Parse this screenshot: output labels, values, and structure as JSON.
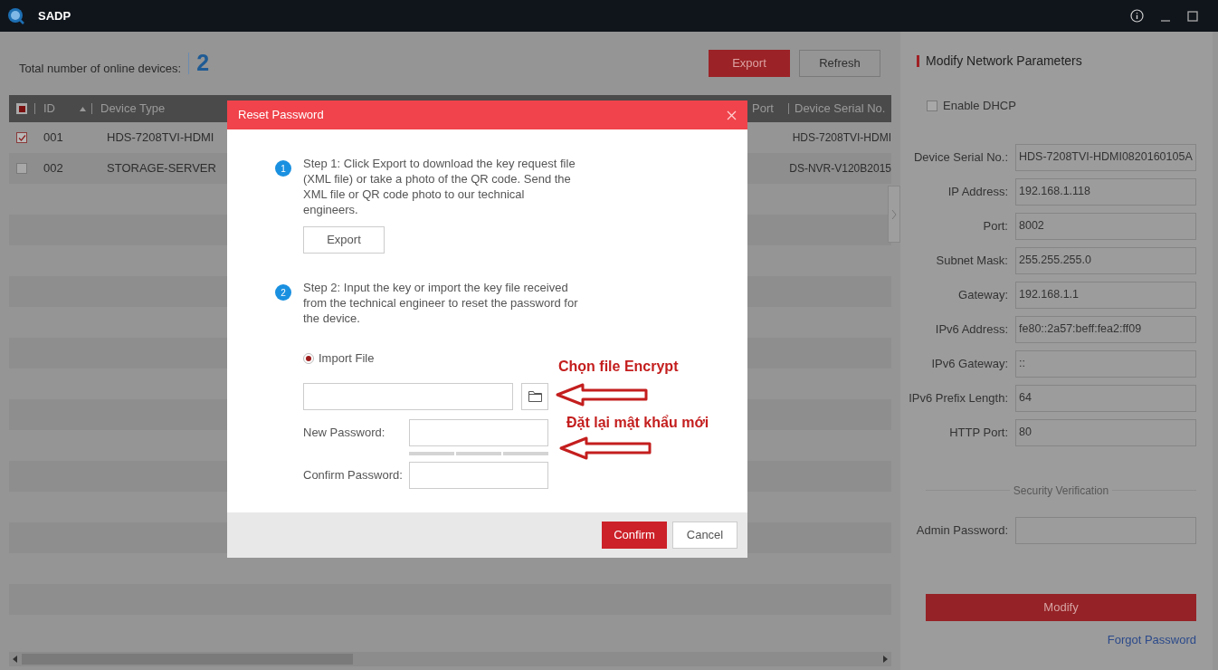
{
  "window": {
    "title": "SADP"
  },
  "toolbar": {
    "total_label": "Total number of online devices:",
    "total_count": "2",
    "buttons": [
      {
        "label": "Export",
        "kind": "primary"
      },
      {
        "label": "Refresh",
        "kind": "secondary"
      }
    ]
  },
  "table": {
    "header_checked": true,
    "columns": [
      "ID",
      "Device Type",
      "Port",
      "Device Serial No."
    ],
    "rows": [
      {
        "checked": true,
        "cells": [
          "001",
          "HDS-7208TVI-HDMI",
          "",
          "HDS-7208TVI-HDMI"
        ]
      },
      {
        "checked": false,
        "cells": [
          "002",
          "STORAGE-SERVER",
          "",
          "DS-NVR-V120B2015"
        ]
      }
    ]
  },
  "panel": {
    "title": "Modify Network Parameters",
    "dhcp": {
      "label": "Enable DHCP",
      "checked": false
    },
    "fields": [
      {
        "label": "Device Serial No.:",
        "value": "HDS-7208TVI-HDMI0820160105A"
      },
      {
        "label": "IP Address:",
        "value": "192.168.1.118"
      },
      {
        "label": "Port:",
        "value": "8002"
      },
      {
        "label": "Subnet Mask:",
        "value": "255.255.255.0"
      },
      {
        "label": "Gateway:",
        "value": "192.168.1.1"
      },
      {
        "label": "IPv6 Address:",
        "value": "fe80::2a57:beff:fea2:ff09"
      },
      {
        "label": "IPv6 Gateway:",
        "value": "::"
      },
      {
        "label": "IPv6 Prefix Length:",
        "value": "64"
      },
      {
        "label": "HTTP Port:",
        "value": "80"
      }
    ],
    "security_title": "Security Verification",
    "admin_label": "Admin Password:",
    "modify": "Modify",
    "forgot": "Forgot Password"
  },
  "dialog": {
    "title": "Reset Password",
    "steps": [
      {
        "number": "1",
        "text": "Step 1: Click Export to download the key request file (XML file) or take a photo of the QR code. Send the XML file or QR code photo to our technical engineers."
      },
      {
        "number": "2",
        "text": "Step 2: Input the key or import the key file received from the technical engineer to reset the password for the device."
      }
    ],
    "export": "Export",
    "import_option": {
      "label": "Import File",
      "selected": true
    },
    "new_password": "New Password:",
    "confirm_password": "Confirm Password:",
    "confirm": "Confirm",
    "cancel": "Cancel"
  },
  "annotations": [
    {
      "text": "Chọn file Encrypt",
      "color": "#c41e1e"
    },
    {
      "text": "Đặt lại mật khẩu mới",
      "color": "#c41e1e"
    }
  ]
}
